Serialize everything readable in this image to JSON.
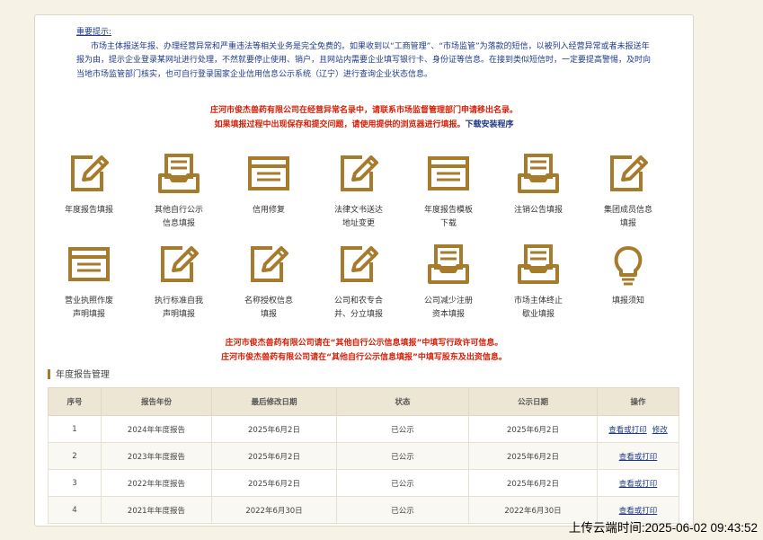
{
  "notice": {
    "title": "重要提示:",
    "paragraph": "市场主体报送年报、办理经营异常和严重违法等相关业务是完全免费的。如果收到以“工商管理”、“市场监管”为落款的短信，以被列入经营异常或者未报送年报为由，提示企业登录某网址进行处理，不然就要停止使用、销户，且网站内需要企业填写银行卡、身份证等信息。在接到类似短信时，一定要提高警惕，及时向当地市场监管部门核实，也可自行登录国家企业信用信息公示系统（辽宁）进行查询企业状态信息。",
    "red_line_1": "庄河市俊杰兽药有限公司在经营异常名录中，请联系市场监督管理部门申请移出名录。",
    "red_line_2": "如果填报过程中出现保存和提交问题，请使用提供的浏览器进行填报。",
    "download_link": "下载安装程序"
  },
  "icons": [
    {
      "label": "年度报告填报",
      "icon": "pencil-doc-icon"
    },
    {
      "label": "其他自行公示\n信息填报",
      "icon": "inbox-tray-icon"
    },
    {
      "label": "信用修复",
      "icon": "form-window-icon"
    },
    {
      "label": "法律文书送达\n地址变更",
      "icon": "pencil-doc-icon"
    },
    {
      "label": "年度报告模板\n下载",
      "icon": "form-window-icon"
    },
    {
      "label": "注销公告填报",
      "icon": "inbox-tray-icon"
    },
    {
      "label": "集团成员信息\n填报",
      "icon": "pencil-doc-icon"
    },
    {
      "label": "营业执照作废\n声明填报",
      "icon": "form-window-icon"
    },
    {
      "label": "执行标准自我\n声明填报",
      "icon": "pencil-doc-icon"
    },
    {
      "label": "名称授权信息\n填报",
      "icon": "pencil-doc-icon"
    },
    {
      "label": "公司和农专合\n并、分立填报",
      "icon": "pencil-doc-icon"
    },
    {
      "label": "公司减少注册\n资本填报",
      "icon": "inbox-tray-icon"
    },
    {
      "label": "市场主体终止\n歇业填报",
      "icon": "inbox-tray-icon"
    },
    {
      "label": "填报须知",
      "icon": "lightbulb-icon"
    }
  ],
  "reminders": {
    "line_1": "庄河市俊杰兽药有限公司请在“其他自行公示信息填报”中填写行政许可信息。",
    "line_2": "庄河市俊杰兽药有限公司请在“其他自行公示信息填报”中填写股东及出资信息。"
  },
  "section_title": "年度报告管理",
  "table": {
    "headers": [
      "序号",
      "报告年份",
      "最后修改日期",
      "状态",
      "公示日期",
      "操作"
    ],
    "rows": [
      {
        "no": "1",
        "year": "2024年年度报告",
        "modified": "2025年6月2日",
        "status": "已公示",
        "published": "2025年6月2日",
        "view": "查看或打印",
        "edit": "修改"
      },
      {
        "no": "2",
        "year": "2023年年度报告",
        "modified": "2025年6月2日",
        "status": "已公示",
        "published": "2025年6月2日",
        "view": "查看或打印"
      },
      {
        "no": "3",
        "year": "2022年年度报告",
        "modified": "2025年6月2日",
        "status": "已公示",
        "published": "2025年6月2日",
        "view": "查看或打印"
      },
      {
        "no": "4",
        "year": "2021年年度报告",
        "modified": "2022年6月30日",
        "status": "已公示",
        "published": "2022年6月30日",
        "view": "查看或打印"
      }
    ]
  },
  "upload_time": "上传云端时间:2025-06-02 09:43:52",
  "colors": {
    "accent_gold": "#a77b2c",
    "warning_red": "#d81e06",
    "link_blue": "#1f3a8a",
    "page_bg": "#f7f2e6"
  }
}
